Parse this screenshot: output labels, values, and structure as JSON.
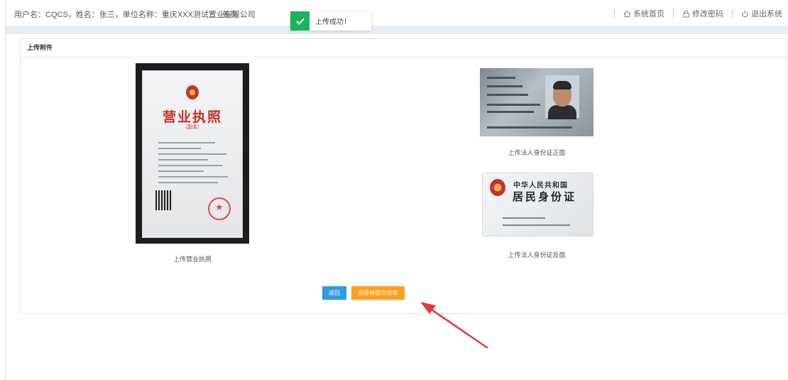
{
  "header": {
    "user_info": "用户名：CQCS，姓名：张三，单位名称：重庆XXX测试置业有限公司",
    "home_link": "首页",
    "nav": [
      {
        "label": "系统首页",
        "icon": "home-icon"
      },
      {
        "label": "修改密码",
        "icon": "lock-icon"
      },
      {
        "label": "退出系统",
        "icon": "power-icon"
      }
    ]
  },
  "toast": {
    "message": "上传成功！",
    "icon": "check-icon",
    "color": "#1ab35d"
  },
  "panel": {
    "title": "上传附件",
    "license": {
      "caption": "上传营业执照",
      "doc_title": "营业执照",
      "doc_sub": "（副本）"
    },
    "id_front": {
      "caption": "上传法人身份证正面"
    },
    "id_back": {
      "caption": "上传法人身份证反面",
      "line1": "中华人民共和国",
      "line2": "居民身份证"
    }
  },
  "buttons": {
    "back": "返回",
    "save": "保存并提交初审"
  },
  "colors": {
    "primary": "#2f9be6",
    "accent": "#ff9e1f",
    "success": "#1ab35d",
    "arrow": "#e53935"
  }
}
